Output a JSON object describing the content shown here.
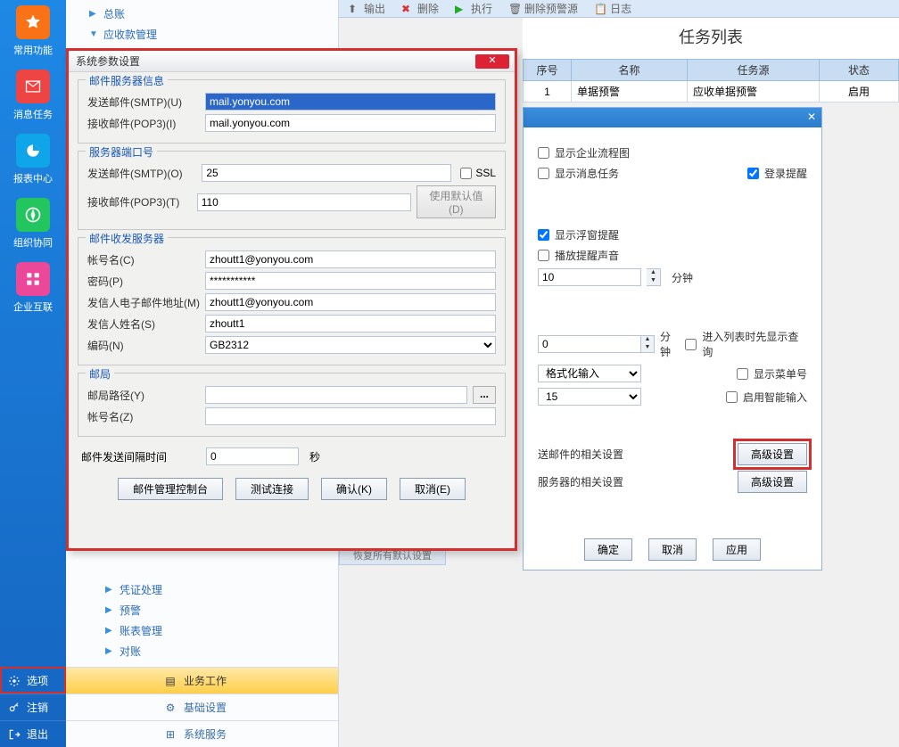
{
  "leftbar": {
    "items": [
      {
        "label": "常用功能"
      },
      {
        "label": "消息任务"
      },
      {
        "label": "报表中心"
      },
      {
        "label": "组织协同"
      },
      {
        "label": "企业互联"
      }
    ],
    "bottom": [
      {
        "label": "选项"
      },
      {
        "label": "注销"
      },
      {
        "label": "退出"
      }
    ]
  },
  "tree": {
    "top": [
      {
        "label": "总账",
        "arrow": "▶"
      },
      {
        "label": "应收款管理",
        "arrow": "▼"
      }
    ],
    "bottom": [
      {
        "label": "凭证处理",
        "arrow": "▶"
      },
      {
        "label": "预警",
        "arrow": "▶"
      },
      {
        "label": "账表管理",
        "arrow": "▶"
      },
      {
        "label": "对账",
        "arrow": "▶"
      }
    ],
    "tabs": [
      {
        "label": "业务工作"
      },
      {
        "label": "基础设置"
      },
      {
        "label": "系统服务"
      }
    ]
  },
  "topstrip": {
    "items": [
      {
        "label": "输出"
      },
      {
        "label": "删除"
      },
      {
        "label": "执行"
      },
      {
        "label": "删除预警源"
      },
      {
        "label": "日志"
      }
    ]
  },
  "tasklist": {
    "title": "任务列表",
    "headers": [
      "序号",
      "名称",
      "任务源",
      "状态"
    ],
    "rows": [
      [
        "1",
        "单据预警",
        "应收单据预警",
        "启用"
      ]
    ]
  },
  "under": {
    "chk_flow": "显示企业流程图",
    "chk_msg": "显示消息任务",
    "chk_login": "登录提醒",
    "chk_float": "显示浮窗提醒",
    "chk_sound": "播放提醒声音",
    "minutes_val": "10",
    "minutes_unit": "分钟",
    "num0": "0",
    "num0_unit": "分钟",
    "chk_list": "进入列表时先显示查询",
    "fmt_label": "格式化输入",
    "chk_menu": "显示菜单号",
    "val15": "15",
    "chk_smart": "启用智能输入",
    "mail_label": "送邮件的相关设置",
    "srv_label": "服务器的相关设置",
    "adv": "高级设置",
    "ok": "确定",
    "cancel": "取消",
    "apply": "应用"
  },
  "resetstrip": "恢复所有默认设置",
  "dialog": {
    "title": "系统参数设置",
    "g1": {
      "legend": "邮件服务器信息",
      "smtp_label": "发送邮件(SMTP)(U)",
      "smtp_val": "mail.yonyou.com",
      "pop3_label": "接收邮件(POP3)(I)",
      "pop3_val": "mail.yonyou.com"
    },
    "g2": {
      "legend": "服务器端口号",
      "smtp_label": "发送邮件(SMTP)(O)",
      "smtp_val": "25",
      "ssl": "SSL",
      "pop3_label": "接收邮件(POP3)(T)",
      "pop3_val": "110",
      "default_btn": "使用默认值(D)"
    },
    "g3": {
      "legend": "邮件收发服务器",
      "acct_label": "帐号名(C)",
      "acct_val": "zhoutt1@yonyou.com",
      "pwd_label": "密码(P)",
      "pwd_val": "***********",
      "from_label": "发信人电子邮件地址(M)",
      "from_val": "zhoutt1@yonyou.com",
      "name_label": "发信人姓名(S)",
      "name_val": "zhoutt1",
      "enc_label": "编码(N)",
      "enc_val": "GB2312"
    },
    "g4": {
      "legend": "邮局",
      "path_label": "邮局路径(Y)",
      "path_val": "",
      "acct_label": "帐号名(Z)",
      "acct_val": ""
    },
    "interval": {
      "label": "邮件发送间隔时间",
      "val": "0",
      "unit": "秒"
    },
    "btns": {
      "console": "邮件管理控制台",
      "test": "测试连接",
      "ok": "确认(K)",
      "cancel": "取消(E)"
    }
  }
}
